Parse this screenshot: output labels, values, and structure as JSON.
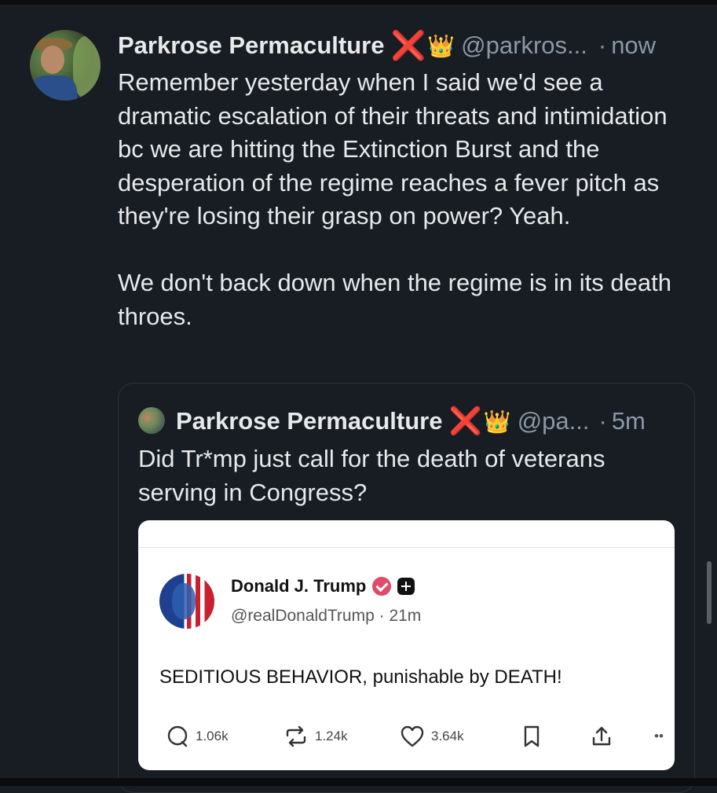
{
  "main_post": {
    "author": "Parkrose Permaculture",
    "emoji_x": "❌",
    "emoji_crown": "👑",
    "handle": "@parkros...",
    "dot": "·",
    "time": "now",
    "paragraph1": "Remember yesterday when I said we'd see a dramatic escalation of their threats and intimidation bc we are hitting the Extinction Burst and the desperation of the regime reaches a fever pitch as they're losing their grasp on power? Yeah.",
    "paragraph2": "We don't back down when the regime is in its death throes."
  },
  "quoted_post": {
    "author": "Parkrose Permaculture",
    "emoji_x": "❌",
    "emoji_crown": "👑",
    "handle": "@pa...",
    "dot": "·",
    "time": "5m",
    "text": "Did Tr*mp just call for the death of veterans serving in Congress?"
  },
  "embedded_truth": {
    "name": "Donald J. Trump",
    "handle_time": "@realDonaldTrump · 21m",
    "body": "SEDITIOUS BEHAVIOR, punishable by DEATH!",
    "replies": "1.06k",
    "retruths": "1.24k",
    "likes": "3.64k",
    "more": "••"
  },
  "colors": {
    "background": "#181c23",
    "text": "#e7e9ea",
    "muted": "#8b98a5",
    "x_red": "#e8231f",
    "verified_pink": "#e24a6a"
  },
  "icons": [
    "reply-icon",
    "retruth-icon",
    "like-icon",
    "bookmark-icon",
    "share-icon",
    "more-icon",
    "verified-icon",
    "plus-badge-icon"
  ]
}
